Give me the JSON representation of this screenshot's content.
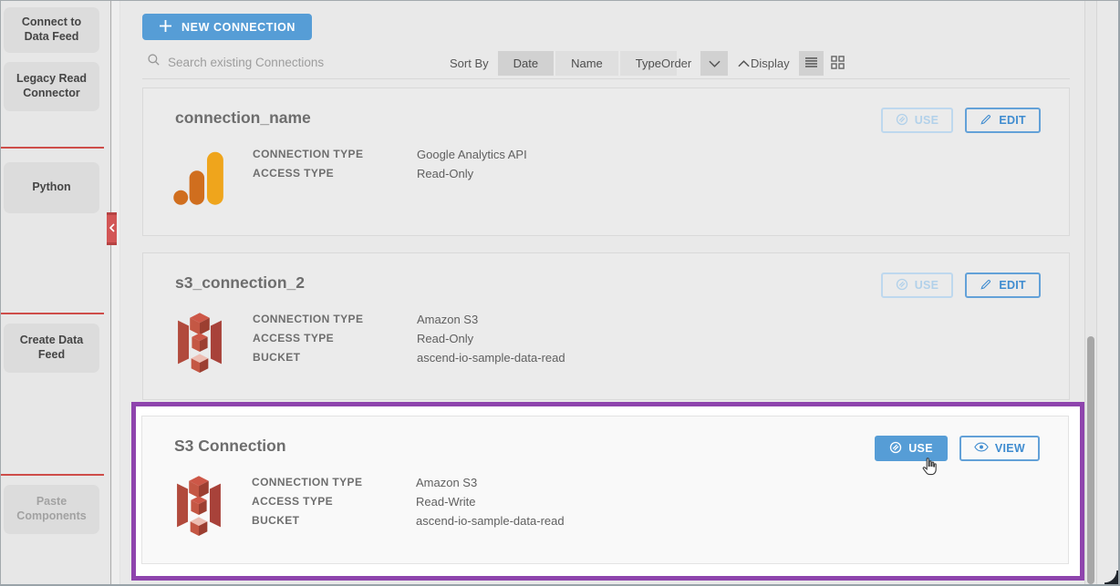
{
  "colors": {
    "accent_blue": "#569dd6",
    "highlight_purple": "#8e44ad",
    "sidebar_red": "#ce4d49",
    "ga_amber": "#efa51c",
    "ga_orange": "#d06e1e",
    "s3_red": "#c45744"
  },
  "sidebar": {
    "items": [
      {
        "label": "Connect to Data Feed",
        "disabled": false
      },
      {
        "label": "Legacy Read Connector",
        "disabled": false
      },
      {
        "label": "Python",
        "disabled": false
      },
      {
        "label": "Create Data Feed",
        "disabled": false
      },
      {
        "label": "Paste Components",
        "disabled": true
      }
    ]
  },
  "toolbar": {
    "new_connection_label": "NEW CONNECTION",
    "search_placeholder": "Search existing Connections",
    "sort_by_label": "Sort By",
    "sort_options": [
      {
        "label": "Date",
        "selected": true
      },
      {
        "label": "Name",
        "selected": false
      },
      {
        "label": "Type",
        "selected": false
      }
    ],
    "order_label": "Order",
    "order_direction_selected": "descending",
    "display_label": "Display",
    "display_mode_selected": "list"
  },
  "connections": [
    {
      "title": "connection_name",
      "icon": "google-analytics-icon",
      "highlighted": false,
      "fields": [
        {
          "label": "CONNECTION TYPE",
          "value": "Google Analytics API"
        },
        {
          "label": "ACCESS TYPE",
          "value": "Read-Only"
        }
      ],
      "buttons": [
        {
          "label": "USE",
          "icon": "ascend-icon",
          "state": "disabled"
        },
        {
          "label": "EDIT",
          "icon": "pencil-icon",
          "state": "enabled"
        }
      ]
    },
    {
      "title": "s3_connection_2",
      "icon": "amazon-s3-icon",
      "highlighted": false,
      "fields": [
        {
          "label": "CONNECTION TYPE",
          "value": "Amazon S3"
        },
        {
          "label": "ACCESS TYPE",
          "value": "Read-Only"
        },
        {
          "label": "BUCKET",
          "value": "ascend-io-sample-data-read"
        }
      ],
      "buttons": [
        {
          "label": "USE",
          "icon": "ascend-icon",
          "state": "disabled"
        },
        {
          "label": "EDIT",
          "icon": "pencil-icon",
          "state": "enabled"
        }
      ]
    },
    {
      "title": "S3 Connection",
      "icon": "amazon-s3-icon",
      "highlighted": true,
      "fields": [
        {
          "label": "CONNECTION TYPE",
          "value": "Amazon S3"
        },
        {
          "label": "ACCESS TYPE",
          "value": "Read-Write"
        },
        {
          "label": "BUCKET",
          "value": "ascend-io-sample-data-read"
        }
      ],
      "buttons": [
        {
          "label": "USE",
          "icon": "ascend-icon",
          "state": "primary"
        },
        {
          "label": "VIEW",
          "icon": "eye-icon",
          "state": "enabled"
        }
      ]
    }
  ]
}
